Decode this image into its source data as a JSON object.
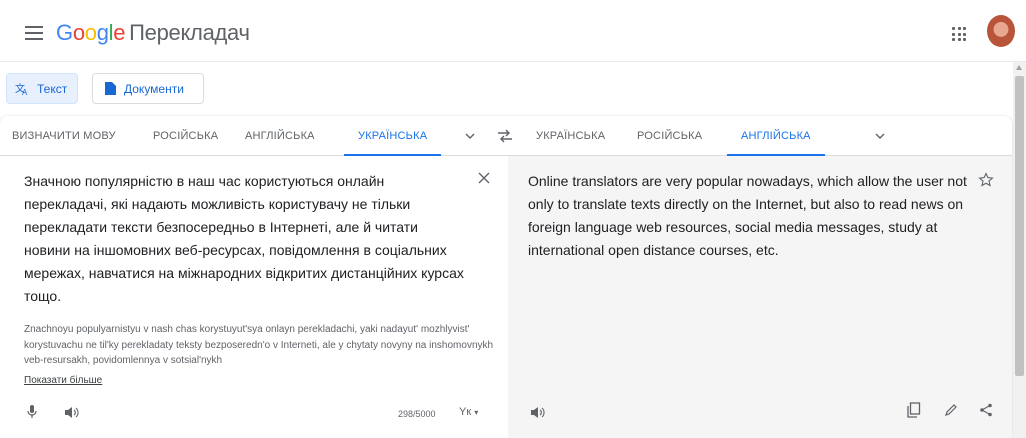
{
  "header": {
    "logo_letters": [
      "G",
      "o",
      "o",
      "g",
      "l",
      "e"
    ],
    "product": "Перекладач",
    "icons": [
      "menu-icon",
      "apps-icon",
      "avatar"
    ]
  },
  "modes": {
    "text_label": "Текст",
    "docs_label": "Документи"
  },
  "source_langs": {
    "detect": "ВИЗНАЧИТИ МОВУ",
    "items": [
      "РОСІЙСЬКА",
      "АНГЛІЙСЬКА",
      "УКРАЇНСЬКА"
    ],
    "active": "УКРАЇНСЬКА"
  },
  "target_langs": {
    "items": [
      "УКРАЇНСЬКА",
      "РОСІЙСЬКА",
      "АНГЛІЙСЬКА"
    ],
    "active": "АНГЛІЙСЬКА"
  },
  "source": {
    "text": "Значною популярністю в наш час користуються онлайн перекладачі, які надають можливість користувачу не тільки перекладати тексти безпосередньо в Інтернеті, але й читати новини на іншомовних веб-ресурсах, повідомлення в соціальних мережах, навчатися на міжнародних відкритих дистанційних курсах тощо.",
    "transliteration": "Znachnoyu populyarnistyu v nash chas korystuyut'sya onlayn perekladachi, yaki nadayut' mozhlyvist' korystuvachu ne til'ky perekladaty teksty bezposeredn'o v Interneti, ale y chytaty novyny na inshomovnykh veb-resursakh, povidomlennya v sotsial'nykh",
    "show_more": "Показати більше",
    "char_count": "298/5000",
    "ime": "Yк"
  },
  "target": {
    "text": "Online translators are very popular nowadays, which allow the user not only to translate texts directly on the Internet, but also to read news on foreign language web resources, social media messages, study at international open distance courses, etc."
  },
  "colors": {
    "accent": "#1a73e8",
    "panel": "#f5f5f5"
  }
}
